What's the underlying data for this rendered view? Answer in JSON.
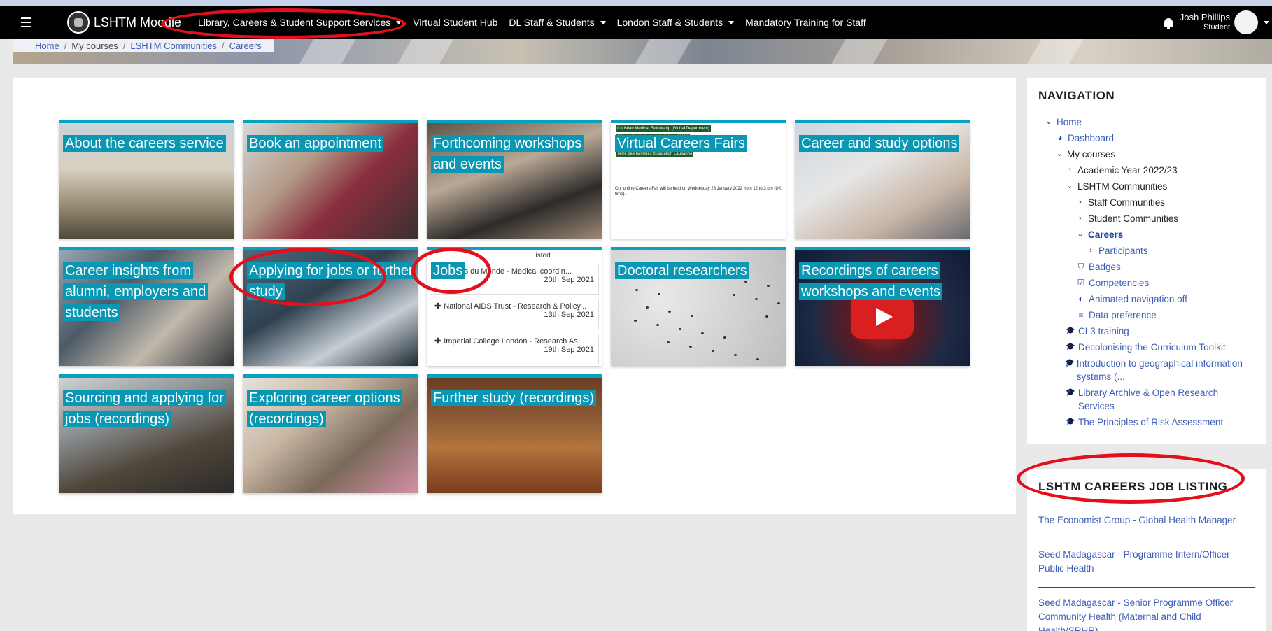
{
  "navbar": {
    "brand": "LSHTM Moodle",
    "menu": [
      {
        "label": "Library, Careers & Student Support Services",
        "dropdown": true
      },
      {
        "label": "Virtual Student Hub",
        "dropdown": false
      },
      {
        "label": "DL Staff & Students",
        "dropdown": true
      },
      {
        "label": "London Staff & Students",
        "dropdown": true
      },
      {
        "label": "Mandatory Training for Staff",
        "dropdown": false
      }
    ],
    "user_name": "Josh Phillips",
    "user_role": "Student"
  },
  "breadcrumb": {
    "home": "Home",
    "my_courses": "My courses",
    "communities": "LSHTM Communities",
    "current": "Careers"
  },
  "tiles": [
    {
      "label": "About the careers service",
      "image": "building-photo"
    },
    {
      "label": "Book an appointment",
      "image": "meeting-photo"
    },
    {
      "label": "Forthcoming workshops and events",
      "image": "event-photo"
    },
    {
      "label": "Virtual Careers Fairs",
      "image": "fair-document"
    },
    {
      "label": "Career and study options",
      "image": "consultation-photo"
    },
    {
      "label": "Career insights from alumni, employers and students",
      "image": "networking-photo"
    },
    {
      "label": "Applying for jobs or further study",
      "image": "laptop-photo"
    },
    {
      "label": "Jobs",
      "image": "job-list"
    },
    {
      "label": "Doctoral researchers",
      "image": "microscope-photo"
    },
    {
      "label": "Recordings of careers workshops and events",
      "image": "youtube-photo"
    },
    {
      "label": "Sourcing and applying for jobs (recordings)",
      "image": "classroom-photo"
    },
    {
      "label": "Exploring career options (recordings)",
      "image": "students-photo"
    },
    {
      "label": "Further study (recordings)",
      "image": "library-photo"
    }
  ],
  "jobs_preview": {
    "header": "listed",
    "rows": [
      {
        "title": "...ecins du Monde - Medical coordin...",
        "date": "20th Sep 2021"
      },
      {
        "title": "National AIDS Trust - Research & Policy...",
        "date": "13th Sep 2021"
      },
      {
        "title": "Imperial College London - Research As...",
        "date": "19th Sep 2021"
      }
    ]
  },
  "fair_doc": {
    "tags": [
      "Christian Medical Fellowship (Global Department)",
      "Clinton Health Access Initiative (CHAI)",
      "Royal Society of Tropical Medicine and Hygiene",
      "Terre des hommes foundation Lausanne"
    ],
    "text": "Our online Careers Fair will be held on Wednesday 26 January 2022 from 12 to 3 pm (UK time)."
  },
  "navigation": {
    "title": "NAVIGATION",
    "items": [
      {
        "label": "Home",
        "level": 0,
        "chev": "v",
        "icon": "",
        "link": true
      },
      {
        "label": "Dashboard",
        "level": 1,
        "chev": "",
        "icon": "dashboard-icon",
        "link": true
      },
      {
        "label": "My courses",
        "level": 1,
        "chev": "v",
        "icon": "",
        "link": false
      },
      {
        "label": "Academic Year 2022/23",
        "level": 2,
        "chev": ">",
        "icon": "",
        "link": false
      },
      {
        "label": "LSHTM Communities",
        "level": 2,
        "chev": "v",
        "icon": "",
        "link": false
      },
      {
        "label": "Staff Communities",
        "level": 3,
        "chev": ">",
        "icon": "",
        "link": false
      },
      {
        "label": "Student Communities",
        "level": 3,
        "chev": ">",
        "icon": "",
        "link": false
      },
      {
        "label": "Careers",
        "level": 3,
        "chev": "v",
        "icon": "",
        "link": true,
        "bold": true
      },
      {
        "label": "Participants",
        "level": 4,
        "chev": ">",
        "icon": "",
        "link": true
      },
      {
        "label": "Badges",
        "level": 3,
        "chev": "",
        "icon": "shield-icon",
        "link": true
      },
      {
        "label": "Competencies",
        "level": 3,
        "chev": "",
        "icon": "checkbox-icon",
        "link": true
      },
      {
        "label": "Animated navigation off",
        "level": 3,
        "chev": "",
        "icon": "toggle-icon",
        "link": true
      },
      {
        "label": "Data preference",
        "level": 3,
        "chev": "",
        "icon": "database-icon",
        "link": true
      },
      {
        "label": "CL3 training",
        "level": 2,
        "chev": "",
        "icon": "graduation-cap-icon",
        "link": true
      },
      {
        "label": "Decolonising the Curriculum Toolkit",
        "level": 2,
        "chev": "",
        "icon": "graduation-cap-icon",
        "link": true
      },
      {
        "label": "Introduction to geographical information systems (...",
        "level": 2,
        "chev": "",
        "icon": "graduation-cap-icon",
        "link": true,
        "wrap": true
      },
      {
        "label": "Library Archive & Open Research Services",
        "level": 2,
        "chev": "",
        "icon": "graduation-cap-icon",
        "link": true,
        "wrap": true
      },
      {
        "label": "The Principles of Risk Assessment",
        "level": 2,
        "chev": "",
        "icon": "graduation-cap-icon",
        "link": true
      }
    ]
  },
  "job_listing": {
    "title": "LSHTM CAREERS JOB LISTING",
    "items": [
      "The Economist Group - Global Health Manager",
      "Seed Madagascar - Programme Intern/Officer Public Health",
      "Seed Madagascar - Senior Programme Officer Community Health (Maternal and Child Health/SRHR)"
    ]
  },
  "colors": {
    "accent": "#0a97b4",
    "link": "#3b5eb7",
    "annotation": "#e3101b"
  }
}
